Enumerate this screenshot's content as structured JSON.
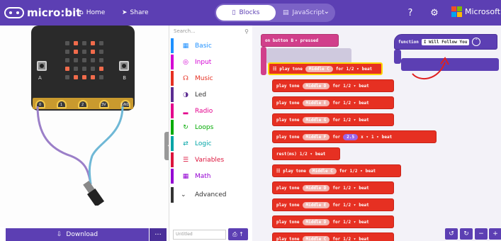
{
  "topbar": {
    "brand": "micro:bit",
    "home_label": "Home",
    "share_label": "Share",
    "blocks_label": "Blocks",
    "javascript_label": "JavaScript",
    "microsoft_label": "Microsoft",
    "colors": {
      "bar": "#5c3fb3"
    }
  },
  "simulator": {
    "button_a": "A",
    "button_b": "B",
    "pin_labels": [
      "0",
      "1",
      "2",
      "3V",
      "GND"
    ],
    "download_label": "Download",
    "more_label": "..."
  },
  "toolbox": {
    "search_placeholder": "Search...",
    "categories": [
      {
        "label": "Basic",
        "color": "#1e90ff",
        "icon": "grid-icon"
      },
      {
        "label": "Input",
        "color": "#d400d4",
        "icon": "target-icon"
      },
      {
        "label": "Music",
        "color": "#e63022",
        "icon": "headphones-icon"
      },
      {
        "label": "Led",
        "color": "#5c2d91",
        "icon": "toggle-icon"
      },
      {
        "label": "Radio",
        "color": "#e3008c",
        "icon": "signal-icon"
      },
      {
        "label": "Loops",
        "color": "#00aa00",
        "icon": "refresh-icon"
      },
      {
        "label": "Logic",
        "color": "#00a4a6",
        "icon": "shuffle-icon"
      },
      {
        "label": "Variables",
        "color": "#dc143c",
        "icon": "list-icon"
      },
      {
        "label": "Math",
        "color": "#9400d3",
        "icon": "calculator-icon"
      }
    ],
    "advanced_label": "Advanced",
    "project_name_placeholder": "Untitled"
  },
  "workspace": {
    "event_block": {
      "text": "on button",
      "button": "B",
      "action": "pressed"
    },
    "function_block": {
      "keyword": "function",
      "name": "I Will Follow You"
    },
    "blocks": [
      {
        "kind": "play",
        "note": "Middle C",
        "beat": "1/2"
      },
      {
        "kind": "play",
        "note": "Middle D",
        "beat": "1/2"
      },
      {
        "kind": "play",
        "note": "Middle E",
        "beat": "1/2"
      },
      {
        "kind": "play",
        "note": "Middle G",
        "beat": "1/2"
      },
      {
        "kind": "play-math",
        "note": "Middle F",
        "factor": "2.5",
        "op": "x",
        "beat": "1"
      },
      {
        "kind": "rest",
        "beat": "1/2"
      },
      {
        "kind": "play",
        "note": "Middle C",
        "beat": "1/2"
      },
      {
        "kind": "play",
        "note": "Middle D",
        "beat": "1/2"
      },
      {
        "kind": "play",
        "note": "Middle E",
        "beat": "1/2"
      },
      {
        "kind": "play",
        "note": "Middle D",
        "beat": "1/2"
      },
      {
        "kind": "play",
        "note": "Middle C",
        "beat": "1/2"
      }
    ],
    "play_tone_label": "play tone",
    "for_label": "for",
    "beat_label": "beat",
    "rest_label": "rest(ms)"
  }
}
